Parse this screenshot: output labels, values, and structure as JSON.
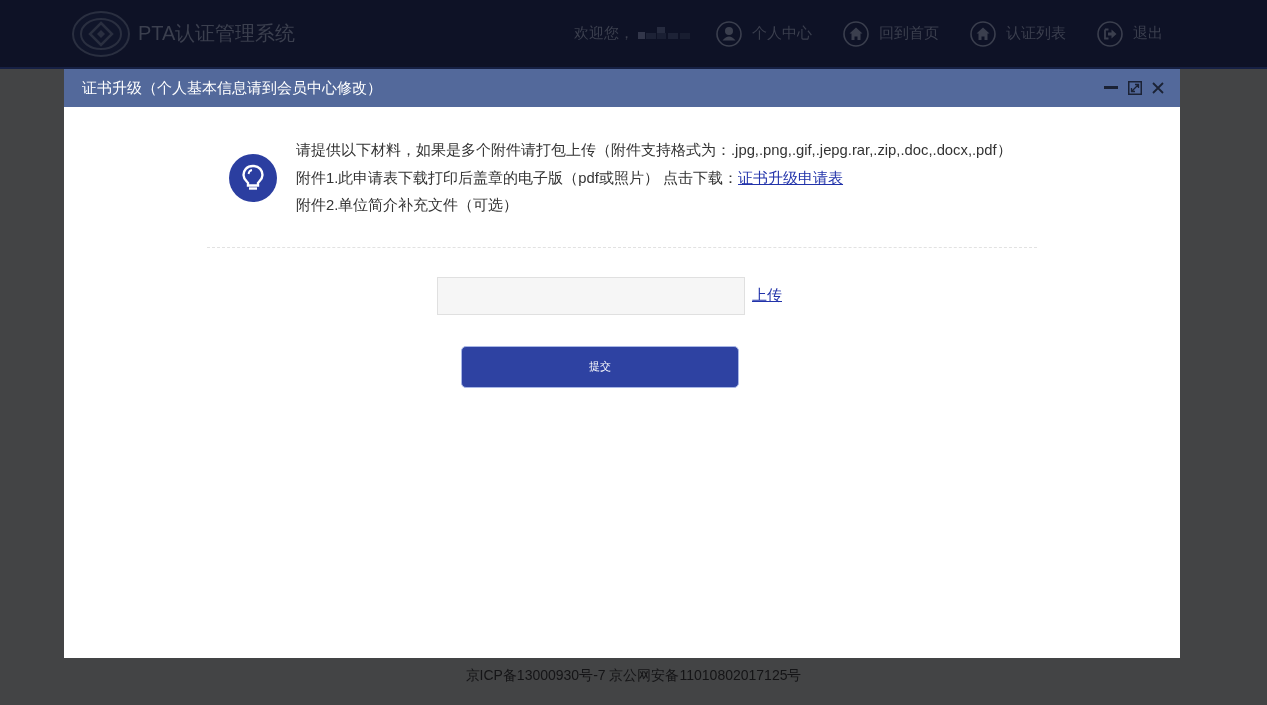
{
  "header": {
    "title": "PTA认证管理系统",
    "welcome": "欢迎您，",
    "nav": [
      {
        "kind": "user",
        "label": "个人中心"
      },
      {
        "kind": "home",
        "label": "回到首页"
      },
      {
        "kind": "home",
        "label": "认证列表"
      },
      {
        "kind": "exit",
        "label": "退出"
      }
    ]
  },
  "dialog": {
    "title": "证书升级（个人基本信息请到会员中心修改）",
    "notice": [
      {
        "text": "请提供以下材料，如果是多个附件请打包上传（附件支持格式为：.jpg,.png,.gif,.jepg.rar,.zip,.doc,.docx,.pdf）"
      },
      {
        "text": "附件1.此申请表下载打印后盖章的电子版（pdf或照片） 点击下载：",
        "link": "证书升级申请表"
      },
      {
        "text": "附件2.单位简介补充文件（可选）"
      }
    ],
    "upload": {
      "link": "上传"
    },
    "submit": "提交"
  },
  "footer": "京ICP备13000930号-7 京公网安备11010802017125号"
}
